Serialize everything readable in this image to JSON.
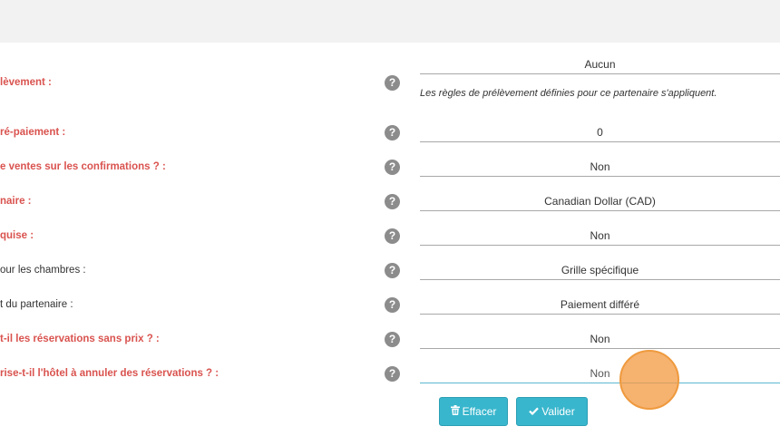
{
  "rows": [
    {
      "label": "lèvement :",
      "required": true
    },
    {
      "label": "ré-paiement :",
      "required": true,
      "value": "0"
    },
    {
      "label": "e ventes sur les confirmations ? :",
      "required": true,
      "value": "Non"
    },
    {
      "label": "naire :",
      "required": true,
      "value": "Canadian Dollar (CAD)"
    },
    {
      "label": "quise :",
      "required": true,
      "value": "Non"
    },
    {
      "label": "our les chambres :",
      "required": false,
      "value": "Grille spécifique"
    },
    {
      "label": "t du partenaire :",
      "required": false,
      "value": "Paiement différé"
    },
    {
      "label": "t-il les réservations sans prix ? :",
      "required": true,
      "value": "Non"
    },
    {
      "label": "rise-t-il l'hôtel à annuler des réservations ? :",
      "required": true,
      "value": "Non"
    }
  ],
  "first_field_value": "Aucun",
  "first_field_note": "Les règles de prélèvement définies pour ce partenaire s'appliquent.",
  "help_glyph": "?",
  "buttons": {
    "clear_label": "Effacer",
    "clear_icon": "trash-icon",
    "validate_label": "Valider",
    "validate_icon": "check-icon"
  },
  "colors": {
    "required_label": "#d9534f",
    "button": "#38b6cd",
    "cursor_highlight": "#f39c46"
  }
}
